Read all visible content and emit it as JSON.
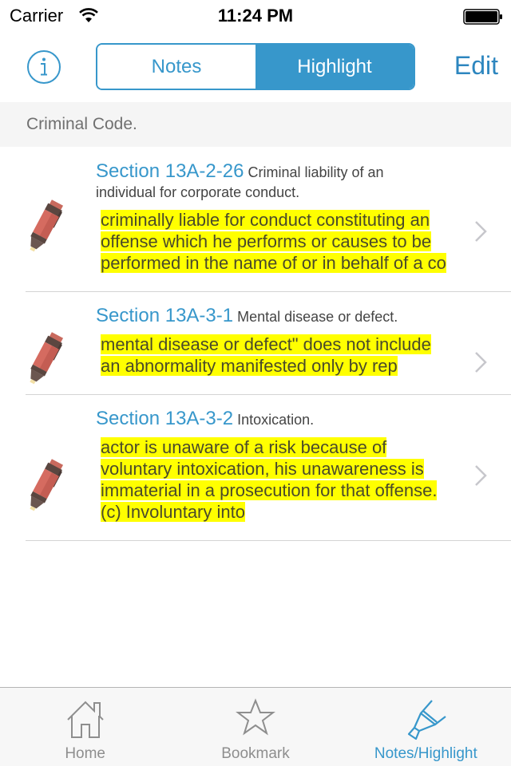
{
  "status_bar": {
    "carrier": "Carrier",
    "time": "11:24 PM"
  },
  "nav": {
    "info_icon": "info-circle-icon",
    "segments": [
      {
        "label": "Notes",
        "selected": false
      },
      {
        "label": "Highlight",
        "selected": true
      }
    ],
    "edit_label": "Edit"
  },
  "section_header": {
    "title": "Criminal Code."
  },
  "items": [
    {
      "code": "Section 13A-2-26",
      "title": "Criminal liability of an individual for corporate conduct.",
      "highlight": "criminally liable for conduct constituting an offense which he performs or causes to be performed in the name of or in behalf of a co"
    },
    {
      "code": "Section 13A-3-1",
      "title": "Mental disease or defect.",
      "highlight": "mental disease or defect\" does not include an abnormality manifested only by rep"
    },
    {
      "code": "Section 13A-3-2",
      "title": "Intoxication.",
      "highlight": "actor is unaware of a risk because of voluntary intoxication, his unawareness is immaterial in a prosecution for that offense.\n(c) Involuntary into"
    }
  ],
  "tabbar": {
    "tabs": [
      {
        "label": "Home",
        "icon": "home-icon",
        "active": false
      },
      {
        "label": "Bookmark",
        "icon": "star-icon",
        "active": false
      },
      {
        "label": "Notes/Highlight",
        "icon": "highlighter-icon",
        "active": true
      }
    ]
  },
  "colors": {
    "accent": "#3797cb",
    "highlight": "#ffff00",
    "header_bg": "#f5f5f5"
  }
}
